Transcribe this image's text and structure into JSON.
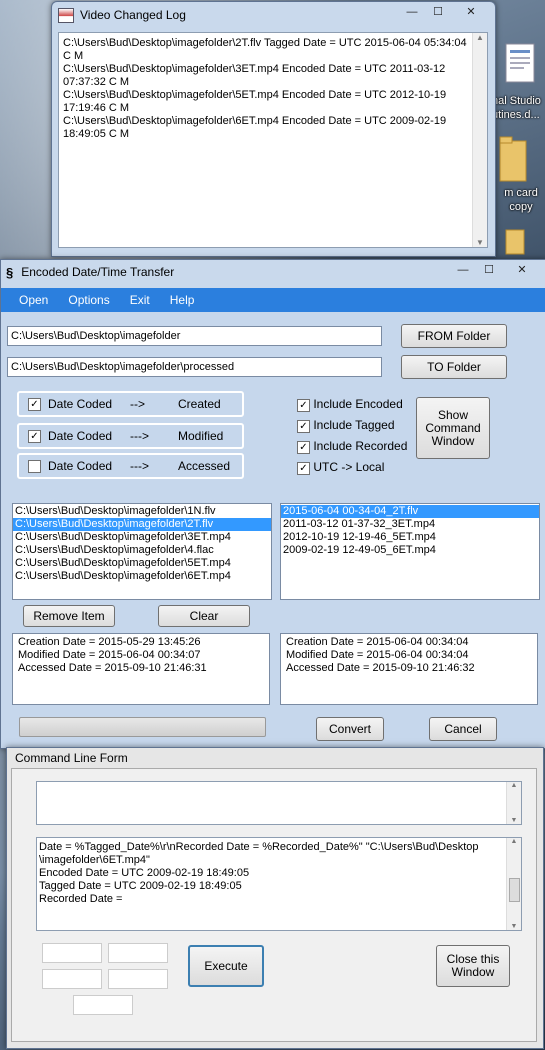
{
  "desktop": {
    "icons": [
      {
        "label_lines": [
          "nal Studio",
          "utines.d..."
        ]
      },
      {
        "label_lines": [
          "m card",
          "copy"
        ]
      }
    ]
  },
  "log_window": {
    "title": "Video Changed Log",
    "lines": [
      "C:\\Users\\Bud\\Desktop\\imagefolder\\2T.flv Tagged Date = UTC 2015-06-04 05:34:04",
      "C M",
      "C:\\Users\\Bud\\Desktop\\imagefolder\\3ET.mp4 Encoded Date = UTC 2011-03-12",
      "07:37:32 C M",
      "C:\\Users\\Bud\\Desktop\\imagefolder\\5ET.mp4 Encoded Date = UTC 2012-10-19",
      "17:19:46 C M",
      "C:\\Users\\Bud\\Desktop\\imagefolder\\6ET.mp4 Encoded Date = UTC 2009-02-19",
      "18:49:05 C M"
    ],
    "controls": {
      "minimize": "—",
      "maximize": "☐",
      "close": "✕"
    }
  },
  "main_window": {
    "title": "Encoded Date/Time Transfer",
    "controls": {
      "minimize": "—",
      "maximize": "☐",
      "close": "✕"
    },
    "menu": [
      "Open",
      "Options",
      "Exit",
      "Help"
    ],
    "from_path": "C:\\Users\\Bud\\Desktop\\imagefolder",
    "to_path": "C:\\Users\\Bud\\Desktop\\imagefolder\\processed",
    "from_button": "FROM Folder",
    "to_button": "TO Folder",
    "mappings": [
      {
        "label": "Date Coded",
        "arrow": "-->",
        "target": "Created",
        "checked": true
      },
      {
        "label": "Date Coded",
        "arrow": "--->",
        "target": "Modified",
        "checked": true
      },
      {
        "label": "Date Coded",
        "arrow": "--->",
        "target": "Accessed",
        "checked": false
      }
    ],
    "options": [
      {
        "label": "Include Encoded",
        "checked": true
      },
      {
        "label": "Include Tagged",
        "checked": true
      },
      {
        "label": "Include Recorded",
        "checked": true
      },
      {
        "label": "UTC -> Local",
        "checked": true
      }
    ],
    "show_cmd_button": [
      "Show",
      "Command",
      "Window"
    ],
    "source_files": [
      "C:\\Users\\Bud\\Desktop\\imagefolder\\1N.flv",
      "C:\\Users\\Bud\\Desktop\\imagefolder\\2T.flv",
      "C:\\Users\\Bud\\Desktop\\imagefolder\\3ET.mp4",
      "C:\\Users\\Bud\\Desktop\\imagefolder\\4.flac",
      "C:\\Users\\Bud\\Desktop\\imagefolder\\5ET.mp4",
      "C:\\Users\\Bud\\Desktop\\imagefolder\\6ET.mp4"
    ],
    "source_selected_index": 1,
    "renamed_files": [
      "2015-06-04 00-34-04_2T.flv",
      "2011-03-12 01-37-32_3ET.mp4",
      "2012-10-19 12-19-46_5ET.mp4",
      "2009-02-19 12-49-05_6ET.mp4"
    ],
    "renamed_selected_index": 0,
    "remove_button": "Remove Item",
    "clear_button": "Clear",
    "source_dates": [
      "Creation Date = 2015-05-29 13:45:26",
      "Modified Date = 2015-06-04 00:34:07",
      "Accessed Date = 2015-09-10 21:46:31"
    ],
    "target_dates": [
      "Creation Date = 2015-06-04 00:34:04",
      "Modified Date = 2015-06-04 00:34:04",
      "Accessed Date = 2015-09-10 21:46:32"
    ],
    "convert_button": "Convert",
    "cancel_button": "Cancel"
  },
  "cmd_window": {
    "title": "Command Line Form",
    "output_lines": [
      "Date = %Tagged_Date%\\r\\nRecorded Date = %Recorded_Date%\" \"C:\\Users\\Bud\\Desktop",
      "\\imagefolder\\6ET.mp4\"",
      "Encoded Date = UTC 2009-02-19 18:49:05",
      "Tagged Date = UTC 2009-02-19 18:49:05",
      "Recorded Date ="
    ],
    "execute_button": "Execute",
    "close_button": [
      "Close this",
      "Window"
    ]
  }
}
